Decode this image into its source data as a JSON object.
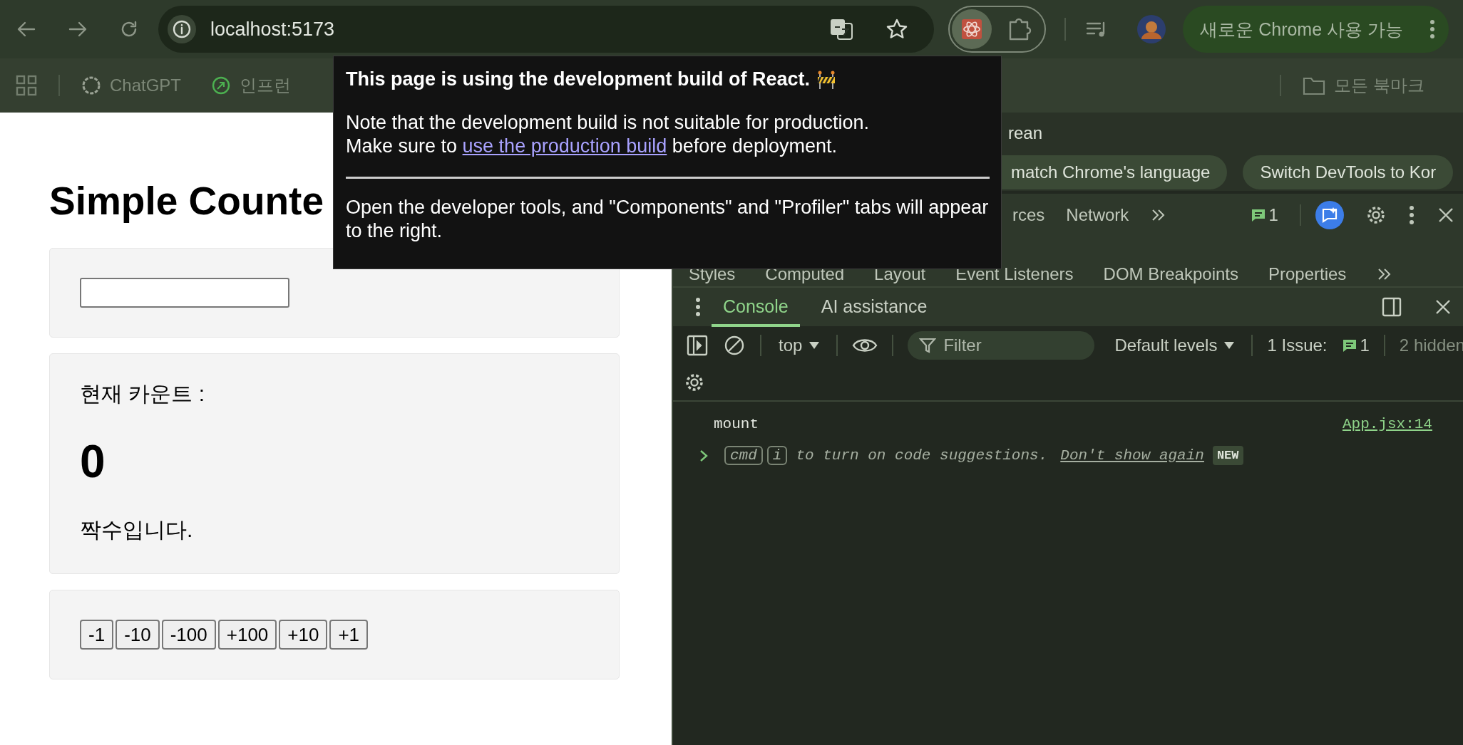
{
  "browser": {
    "url": "localhost:5173",
    "update_chip": "새로운 Chrome 사용 가능",
    "bookmarks": [
      {
        "label": "ChatGPT"
      },
      {
        "label": "인프런"
      }
    ],
    "all_bookmarks": "모든 북마크"
  },
  "page": {
    "title": "Simple Counte",
    "count_label": "현재 카운트 :",
    "count": "0",
    "parity": "짝수입니다.",
    "buttons": [
      "-1",
      "-10",
      "-100",
      "+100",
      "+10",
      "+1"
    ]
  },
  "popup": {
    "title": "This page is using the development build of React.",
    "note": "Note that the development build is not suitable for production.",
    "link_before": "Make sure to",
    "link": "use the production build",
    "link_after": "before deployment.",
    "footer": "Open the developer tools, and \"Components\" and \"Profiler\" tabs will appear to the right."
  },
  "devtools": {
    "infobar_text": "rean",
    "infobar_buttons": [
      "match Chrome's language",
      "Switch DevTools to Kor"
    ],
    "tabs": [
      {
        "label": "rces",
        "selected": false
      },
      {
        "label": "Network",
        "selected": false
      }
    ],
    "issues_count": "1",
    "subtabs": [
      "Styles",
      "Computed",
      "Layout",
      "Event Listeners",
      "DOM Breakpoints",
      "Properties"
    ],
    "drawer_tabs": [
      {
        "label": "Console",
        "selected": true
      },
      {
        "label": "AI assistance",
        "selected": false
      }
    ],
    "context": "top",
    "filter_placeholder": "Filter",
    "levels": "Default levels",
    "issue_label": "1 Issue:",
    "issue_count": "1",
    "hidden": "2 hidden",
    "messages": [
      {
        "text": "mount",
        "source": "App.jsx:14"
      }
    ],
    "hint": {
      "keys": [
        "cmd",
        "i"
      ],
      "text": "to turn on code suggestions.",
      "link": "Don't show again",
      "badge": "NEW"
    }
  }
}
